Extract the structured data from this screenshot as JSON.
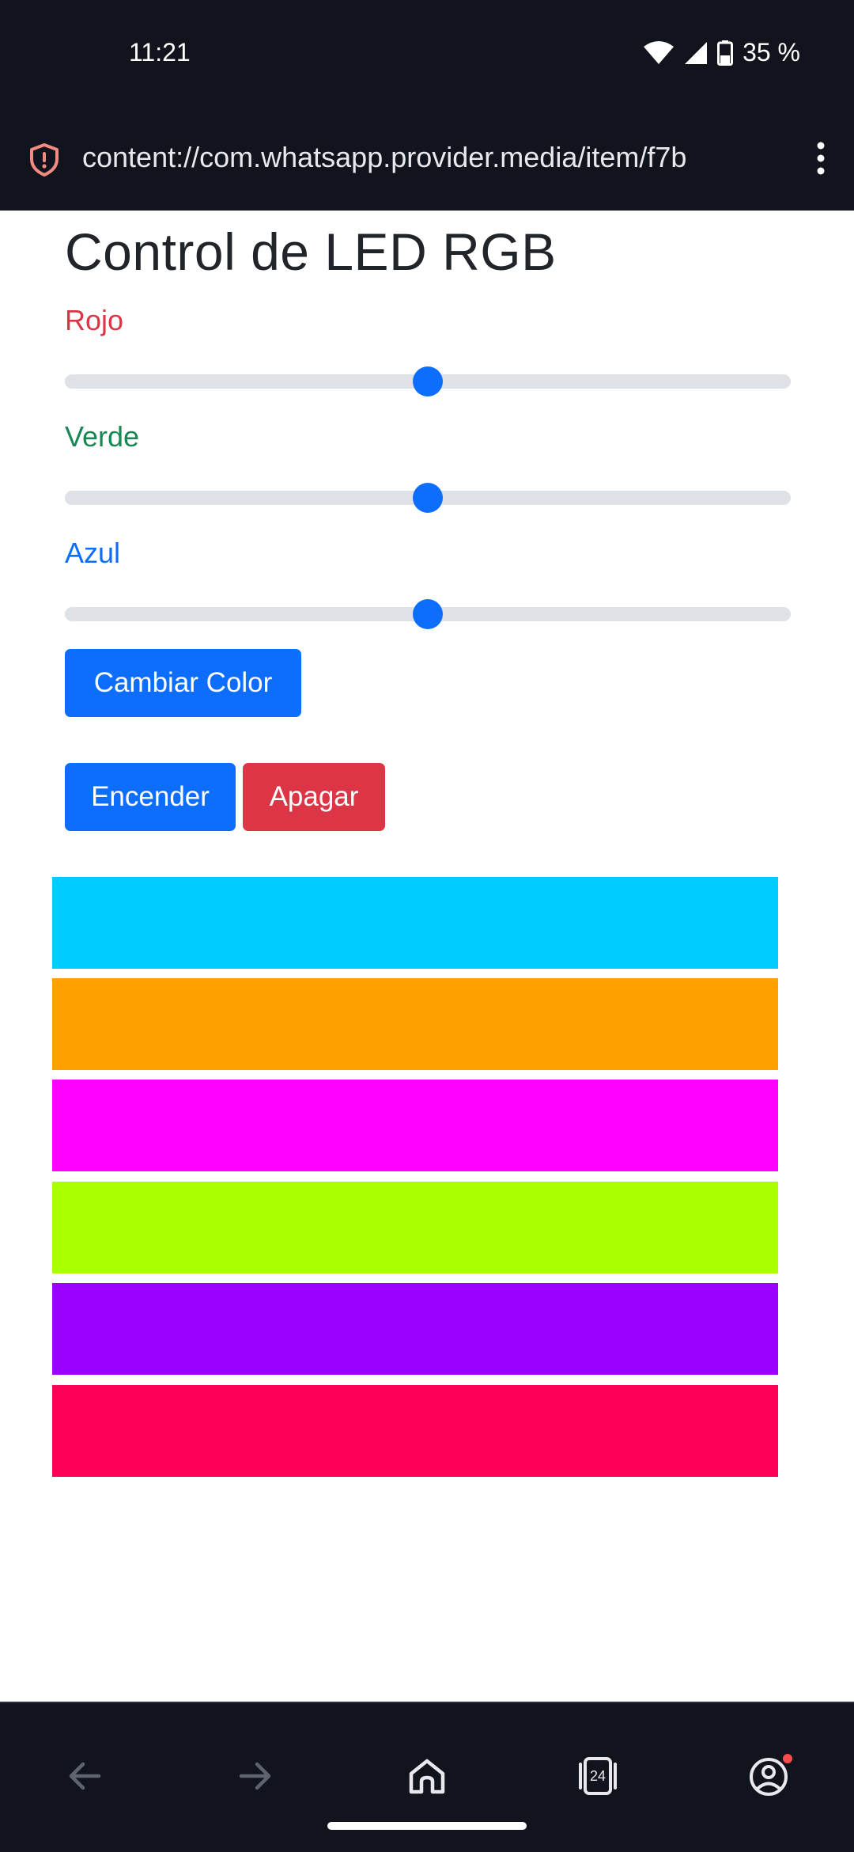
{
  "status_bar": {
    "time": "11:21",
    "battery": "35 %",
    "icons": [
      "wifi-icon",
      "signal-icon",
      "battery-icon"
    ]
  },
  "browser": {
    "url": "content://com.whatsapp.provider.media/item/f7b",
    "security_icon": "shield-alert-icon",
    "menu_icon": "kebab-menu-icon"
  },
  "page": {
    "title": "Control de LED RGB",
    "sliders": [
      {
        "label": "Rojo",
        "color": "#dc3545",
        "value_fraction": 0.5
      },
      {
        "label": "Verde",
        "color": "#198754",
        "value_fraction": 0.5
      },
      {
        "label": "Azul",
        "color": "#0d6efd",
        "value_fraction": 0.5
      }
    ],
    "change_color_button": "Cambiar Color",
    "on_button": "Encender",
    "off_button": "Apagar",
    "swatches": [
      "#00ccff",
      "#ffa200",
      "#ff00ff",
      "#aaff00",
      "#9900ff",
      "#ff0059"
    ]
  },
  "bottom_nav": {
    "tab_count": "24",
    "items": [
      "back-icon",
      "forward-icon",
      "home-icon",
      "tabs-icon",
      "account-icon"
    ]
  }
}
